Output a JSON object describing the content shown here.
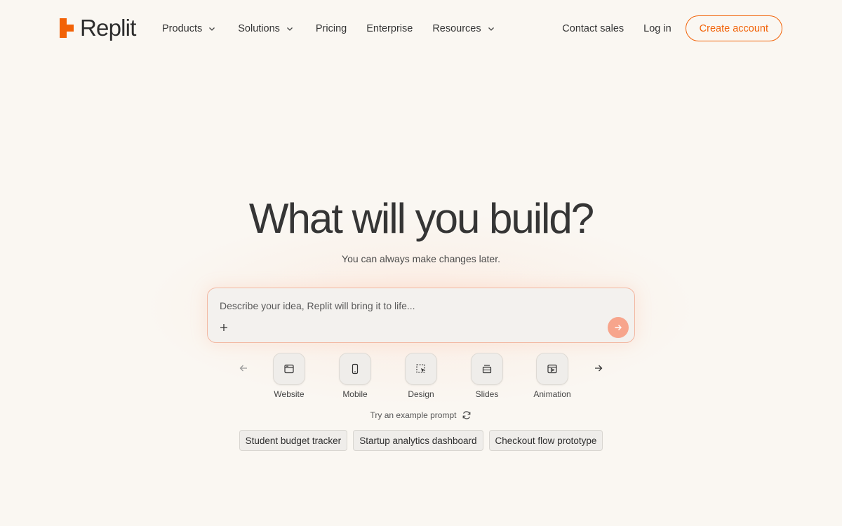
{
  "brand": {
    "name": "Replit",
    "accent_color": "#f26207",
    "logo_icon": "replit-logo-icon"
  },
  "nav": {
    "items": [
      {
        "label": "Products",
        "has_dropdown": true
      },
      {
        "label": "Solutions",
        "has_dropdown": true
      },
      {
        "label": "Pricing",
        "has_dropdown": false
      },
      {
        "label": "Enterprise",
        "has_dropdown": false
      },
      {
        "label": "Resources",
        "has_dropdown": true
      }
    ]
  },
  "header_actions": {
    "contact_sales": "Contact sales",
    "log_in": "Log in",
    "create_account": "Create account"
  },
  "hero": {
    "title": "What will you build?",
    "subtitle": "You can always make changes later."
  },
  "prompt": {
    "placeholder": "Describe your idea, Replit will bring it to life...",
    "value": "",
    "attach_icon": "plus-icon",
    "send_icon": "arrow-right-icon",
    "send_color": "#f7a58c"
  },
  "app_types": [
    {
      "label": "Website",
      "icon": "browser-window-icon"
    },
    {
      "label": "Mobile",
      "icon": "phone-icon"
    },
    {
      "label": "Design",
      "icon": "design-select-icon"
    },
    {
      "label": "Slides",
      "icon": "slides-icon"
    },
    {
      "label": "Animation",
      "icon": "animation-icon"
    }
  ],
  "examples": {
    "label": "Try an example prompt",
    "refresh_icon": "refresh-icon",
    "chips": [
      "Student budget tracker",
      "Startup analytics dashboard",
      "Checkout flow prototype"
    ]
  }
}
